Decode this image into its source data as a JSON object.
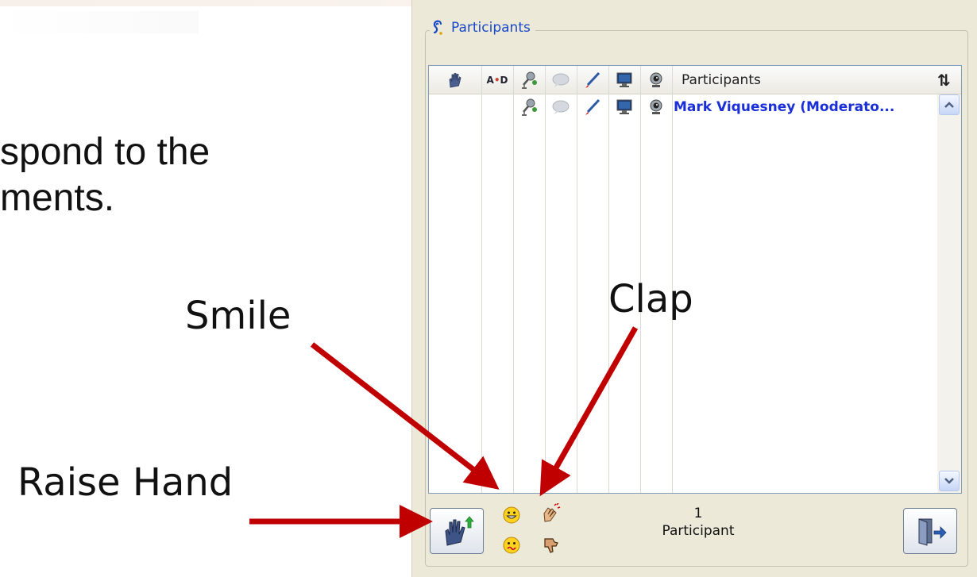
{
  "slide": {
    "line1": "spond to the",
    "line2": "ments.",
    "callouts": {
      "smile": "Smile",
      "clap": "Clap",
      "raise_hand": "Raise Hand"
    },
    "arrow_color": "#c00000"
  },
  "panel": {
    "title": "Participants",
    "title_icon": "participants-ear-icon",
    "header": {
      "columns": [
        {
          "name": "raise-hand-column",
          "icon": "hand-icon"
        },
        {
          "name": "alphabetical-sort-column",
          "icon": "a-d-icon",
          "text": "A-D"
        },
        {
          "name": "microphone-column",
          "icon": "microphone-icon"
        },
        {
          "name": "chat-column",
          "icon": "chat-bubble-icon"
        },
        {
          "name": "whiteboard-column",
          "icon": "pencil-icon"
        },
        {
          "name": "app-share-column",
          "icon": "monitor-icon"
        },
        {
          "name": "webcam-column",
          "icon": "webcam-icon"
        }
      ],
      "label": "Participants",
      "sort_icon": "⇅"
    },
    "rows": [
      {
        "name": "Mark Viquesney (Moderato...",
        "color": "#1a2fd8"
      }
    ],
    "footer": {
      "raise_hand_button": "raise-hand-button",
      "emotes": [
        "smile-icon",
        "clap-icon",
        "confused-icon",
        "thumbs-down-icon"
      ],
      "count_value": "1",
      "count_label": "Participant",
      "leave_button": "leave-room-button"
    }
  }
}
